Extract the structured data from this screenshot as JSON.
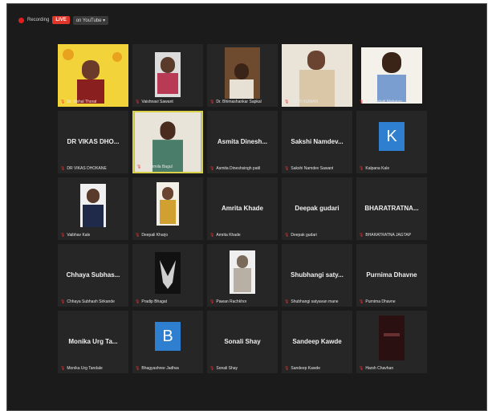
{
  "topbar": {
    "rec_label": "Recording",
    "live_label": "LIVE",
    "view_label": "on YouTube ▾"
  },
  "tiles": [
    {
      "name": "Dr. Vishal Thorat",
      "initial": "",
      "big": "",
      "kind": "video"
    },
    {
      "name": "Vaishnavi Sawant",
      "initial": "",
      "big": "",
      "kind": "video"
    },
    {
      "name": "Dr. Bhimashankar Sapkal",
      "initial": "",
      "big": "",
      "kind": "video"
    },
    {
      "name": "SAKTI KUMAR",
      "initial": "",
      "big": "",
      "kind": "video"
    },
    {
      "name": "Dr. Vaishali Mahajan",
      "initial": "",
      "big": "",
      "kind": "video"
    },
    {
      "name": "DR VIKAS DHOKANE",
      "initial": "",
      "big": "DR VIKAS DHO...",
      "kind": "text"
    },
    {
      "name": "Dr. Urmila Bagul",
      "initial": "",
      "big": "",
      "kind": "video"
    },
    {
      "name": "Asmita Dineshsingh patil",
      "initial": "",
      "big": "Asmita Dinesh...",
      "kind": "text"
    },
    {
      "name": "Sakshi Namdev Sawant",
      "initial": "",
      "big": "Sakshi Namdev...",
      "kind": "text"
    },
    {
      "name": "Kalpana Kale",
      "initial": "K",
      "big": "",
      "kind": "initial"
    },
    {
      "name": "Vaibhav Kale",
      "initial": "",
      "big": "",
      "kind": "video"
    },
    {
      "name": "Deepali Kharjo",
      "initial": "",
      "big": "",
      "kind": "video"
    },
    {
      "name": "Amrita Khade",
      "initial": "",
      "big": "Amrita Khade",
      "kind": "text"
    },
    {
      "name": "Deepak gudari",
      "initial": "",
      "big": "Deepak gudari",
      "kind": "text"
    },
    {
      "name": "BHARATRATNA JAGTAP",
      "initial": "",
      "big": "BHARATRATNA...",
      "kind": "text"
    },
    {
      "name": "Chhaya Subhash Sirkande",
      "initial": "",
      "big": "Chhaya Subhas...",
      "kind": "text"
    },
    {
      "name": "Pradip Bhagat",
      "initial": "",
      "big": "",
      "kind": "video"
    },
    {
      "name": "Pawan Rachkhor",
      "initial": "",
      "big": "",
      "kind": "video"
    },
    {
      "name": "Shubhangi satyavan mane",
      "initial": "",
      "big": "Shubhangi saty...",
      "kind": "text"
    },
    {
      "name": "Purnima Dhavne",
      "initial": "",
      "big": "Purnima Dhavne",
      "kind": "text"
    },
    {
      "name": "Monika Urg Tandale",
      "initial": "",
      "big": "Monika Urg Ta...",
      "kind": "text"
    },
    {
      "name": "Bhagyashree Jadhav",
      "initial": "B",
      "big": "",
      "kind": "initial"
    },
    {
      "name": "Sonali Shay",
      "initial": "",
      "big": "Sonali Shay",
      "kind": "text"
    },
    {
      "name": "Sandeep Kawde",
      "initial": "",
      "big": "Sandeep Kawde",
      "kind": "text"
    },
    {
      "name": "Harsh Chavhan",
      "initial": "",
      "big": "",
      "kind": "video"
    }
  ],
  "colors": {
    "speaker_border": "#d8d046",
    "initial_bg": "#2e7fd0",
    "live": "#e0352b"
  }
}
